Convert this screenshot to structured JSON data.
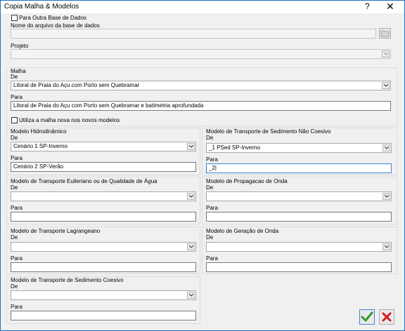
{
  "window": {
    "title": "Copia Malha & Modelos",
    "help_glyph": "?",
    "close_glyph": "✕"
  },
  "database": {
    "other_db_label": "Para Outra Base de Dados",
    "other_db_checked": false,
    "file_label": "Nome do arquivo da base de dados",
    "file_value": "",
    "project_label": "Projeto",
    "project_value": ""
  },
  "mesh": {
    "group_label": "Malha",
    "from_label": "De",
    "from_value": "Litoral de Praia do Açu com Porto sem Quebramar",
    "to_label": "Para",
    "to_value": "Litoral de Praia do Açu com Porto sem Quebramar e batimetria aprofundada",
    "use_new_label": "Utiliza a malha nova nos novos modelos",
    "use_new_checked": false
  },
  "models": {
    "hydro": {
      "label": "Modelo Hidrodinâmico",
      "from_label": "De",
      "from_value": "Cenário 1 SP-Inverno",
      "to_label": "Para",
      "to_value": "Cenário 2 SP-Verão"
    },
    "noncohesive": {
      "label": "Modelo de Transporte de Sedimento Não Coesivo",
      "from_label": "De",
      "from_value": "_1 PSed SP-Inverno",
      "to_label": "Para",
      "to_value": "_2|"
    },
    "eulerian": {
      "label": "Modelo de Transporte Eulleriano ou de Qualidade de Água",
      "from_label": "De",
      "from_value": "",
      "to_label": "Para",
      "to_value": ""
    },
    "wave": {
      "label": "Modelo de Propagacao de Onda",
      "from_label": "De",
      "from_value": "",
      "to_label": "Para",
      "to_value": ""
    },
    "lagrangian": {
      "label": "Modelo de Transporte Lagrangeano",
      "from_label": "De",
      "from_value": "",
      "to_label": "Para",
      "to_value": ""
    },
    "waveGen": {
      "label": "Modelo de Geração de Onda",
      "from_label": "De",
      "from_value": "",
      "to_label": "Para",
      "to_value": ""
    },
    "cohesive": {
      "label": "Modelo de Transporte de Sedimento Coesivo",
      "from_label": "De",
      "from_value": "",
      "to_label": "Para",
      "to_value": ""
    }
  },
  "buttons": {
    "ok_icon": "check-icon",
    "cancel_icon": "cancel-x-icon",
    "ok_color": "#2e9c2e",
    "cancel_color": "#d31d1d"
  }
}
